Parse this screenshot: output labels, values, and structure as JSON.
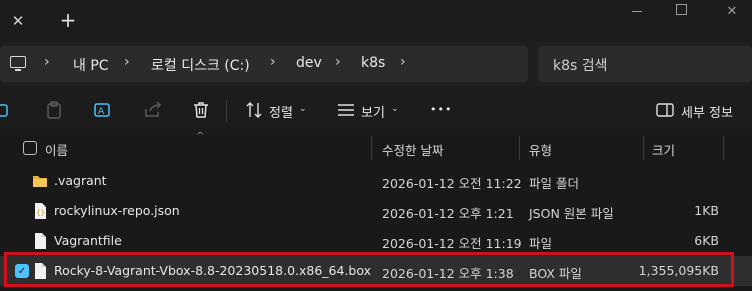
{
  "tabbar": {
    "close_glyph": "✕",
    "add_glyph": "+"
  },
  "address": {
    "crumbs": [
      "내 PC",
      "로컬 디스크 (C:)",
      "dev",
      "k8s"
    ],
    "separator": "›"
  },
  "search": {
    "placeholder": "k8s 검색"
  },
  "toolbar": {
    "sort_label": "정렬",
    "view_label": "보기",
    "more_label": "•••",
    "details_label": "세부 정보"
  },
  "columns": {
    "name": "이름",
    "modified": "수정한 날짜",
    "type": "유형",
    "size": "크기"
  },
  "files": [
    {
      "name": ".vagrant",
      "modified": "2026-01-12 오전 11:22",
      "type": "파일 폴더",
      "size": "",
      "icon": "folder-icon"
    },
    {
      "name": "rockylinux-repo.json",
      "modified": "2026-01-12 오후 1:21",
      "type": "JSON 원본 파일",
      "size": "1KB",
      "icon": "json-file-icon"
    },
    {
      "name": "Vagrantfile",
      "modified": "2026-01-12 오전 11:19",
      "type": "파일",
      "size": "6KB",
      "icon": "file-icon"
    },
    {
      "name": "Rocky-8-Vagrant-Vbox-8.8-20230518.0.x86_64.box",
      "modified": "2026-01-12 오후 1:38",
      "type": "BOX 파일",
      "size": "1,355,095KB",
      "icon": "file-icon",
      "selected": true
    }
  ],
  "colors": {
    "accent": "#4cc2ff",
    "highlight_border": "#d0101c",
    "folder": "#e8b33c"
  }
}
